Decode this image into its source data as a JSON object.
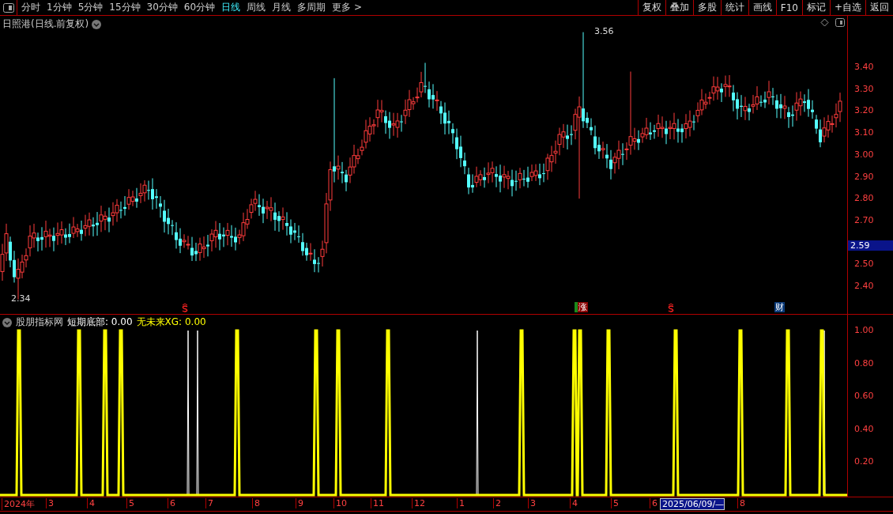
{
  "toolbar": {
    "periods": [
      {
        "label": "分时",
        "selected": false
      },
      {
        "label": "1分钟",
        "selected": false
      },
      {
        "label": "5分钟",
        "selected": false
      },
      {
        "label": "15分钟",
        "selected": false
      },
      {
        "label": "30分钟",
        "selected": false
      },
      {
        "label": "60分钟",
        "selected": false
      },
      {
        "label": "日线",
        "selected": true
      },
      {
        "label": "周线",
        "selected": false
      },
      {
        "label": "月线",
        "selected": false
      },
      {
        "label": "多周期",
        "selected": false
      },
      {
        "label": "更多 >",
        "selected": false
      }
    ],
    "buttons": [
      "复权",
      "叠加",
      "多股",
      "统计",
      "画线",
      "F10",
      "标记",
      "+自选",
      "返回"
    ]
  },
  "main_chart": {
    "title": "日照港(日线.前复权)",
    "high_label": "3.56",
    "low_label": "2.34",
    "current_price": "2.59",
    "price_axis": [
      "3.40",
      "3.30",
      "3.20",
      "3.10",
      "3.00",
      "2.90",
      "2.80",
      "2.70",
      "2.50",
      "2.40"
    ],
    "events": [
      {
        "kind": "dividend"
      },
      {
        "kind": "limit",
        "text": "涨"
      },
      {
        "kind": "dividend"
      },
      {
        "kind": "finance",
        "text": "财"
      }
    ]
  },
  "indicator": {
    "name": "股朋指标网",
    "values": [
      {
        "label": "短期底部: 0.00",
        "color": "#ffffff"
      },
      {
        "label": "无未来XG: 0.00",
        "color": "#ffff00"
      }
    ],
    "axis": [
      "1.00",
      "0.80",
      "0.60",
      "0.40",
      "0.20"
    ]
  },
  "time_axis": [
    {
      "label": "2024年",
      "kind": "tick"
    },
    {
      "label": "3",
      "kind": "tick"
    },
    {
      "label": "4",
      "kind": "tick"
    },
    {
      "label": "5",
      "kind": "tick"
    },
    {
      "label": "6",
      "kind": "tick"
    },
    {
      "label": "7",
      "kind": "tick"
    },
    {
      "label": "8",
      "kind": "tick"
    },
    {
      "label": "9",
      "kind": "tick"
    },
    {
      "label": "10",
      "kind": "tick"
    },
    {
      "label": "11",
      "kind": "tick"
    },
    {
      "label": "12",
      "kind": "tick"
    },
    {
      "label": "1",
      "kind": "tick"
    },
    {
      "label": "2",
      "kind": "tick"
    },
    {
      "label": "3",
      "kind": "tick"
    },
    {
      "label": "4",
      "kind": "tick"
    },
    {
      "label": "5",
      "kind": "tick"
    },
    {
      "label": "6",
      "kind": "tick"
    },
    {
      "label": "2025/06/09/—",
      "kind": "cursor"
    },
    {
      "label": "8",
      "kind": "tick"
    }
  ]
}
